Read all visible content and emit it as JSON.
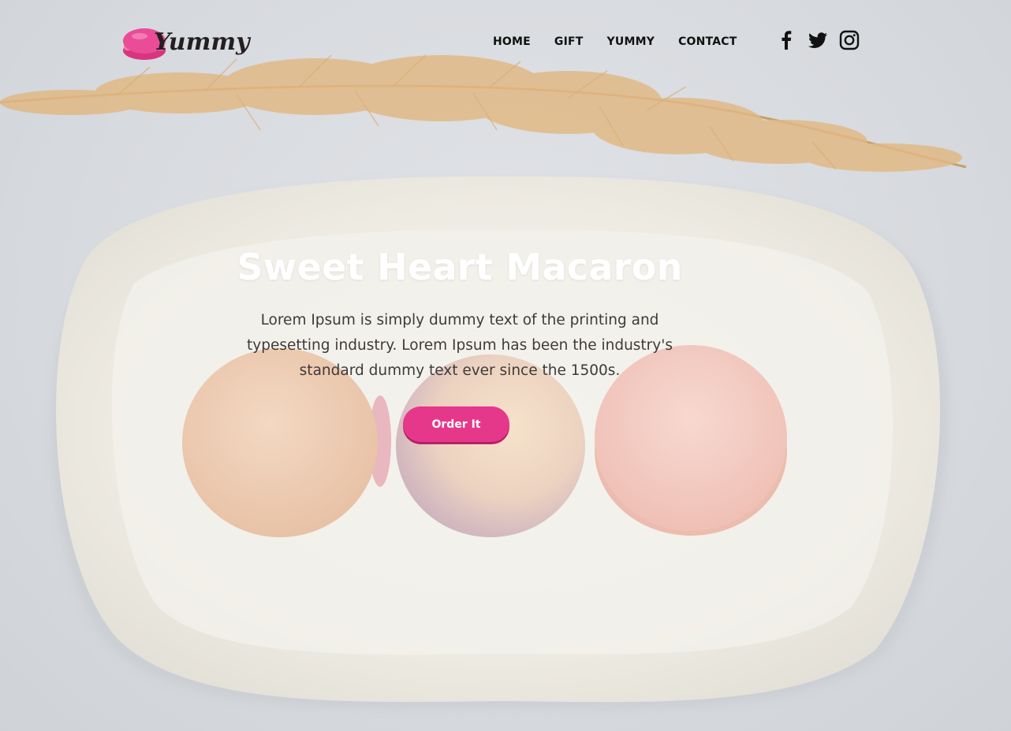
{
  "brand": {
    "name": "Yummy",
    "accent": "#e6388a"
  },
  "nav": {
    "items": [
      {
        "label": "HOME"
      },
      {
        "label": "GIFT"
      },
      {
        "label": "YUMMY"
      },
      {
        "label": "CONTACT"
      }
    ]
  },
  "social": {
    "icons": [
      "facebook-icon",
      "twitter-icon",
      "instagram-icon"
    ]
  },
  "hero": {
    "title": "Sweet Heart Macaron",
    "description": "Lorem Ipsum is simply dummy text of the printing and typesetting industry. Lorem Ipsum has been the industry's standard dummy text ever since the 1500s.",
    "cta_label": "Order It"
  },
  "colors": {
    "background": "#d6d9de",
    "plate": "#f1eee6",
    "button": "#e6388a",
    "title_text": "#ffffff",
    "body_text": "#3f3a3a"
  }
}
